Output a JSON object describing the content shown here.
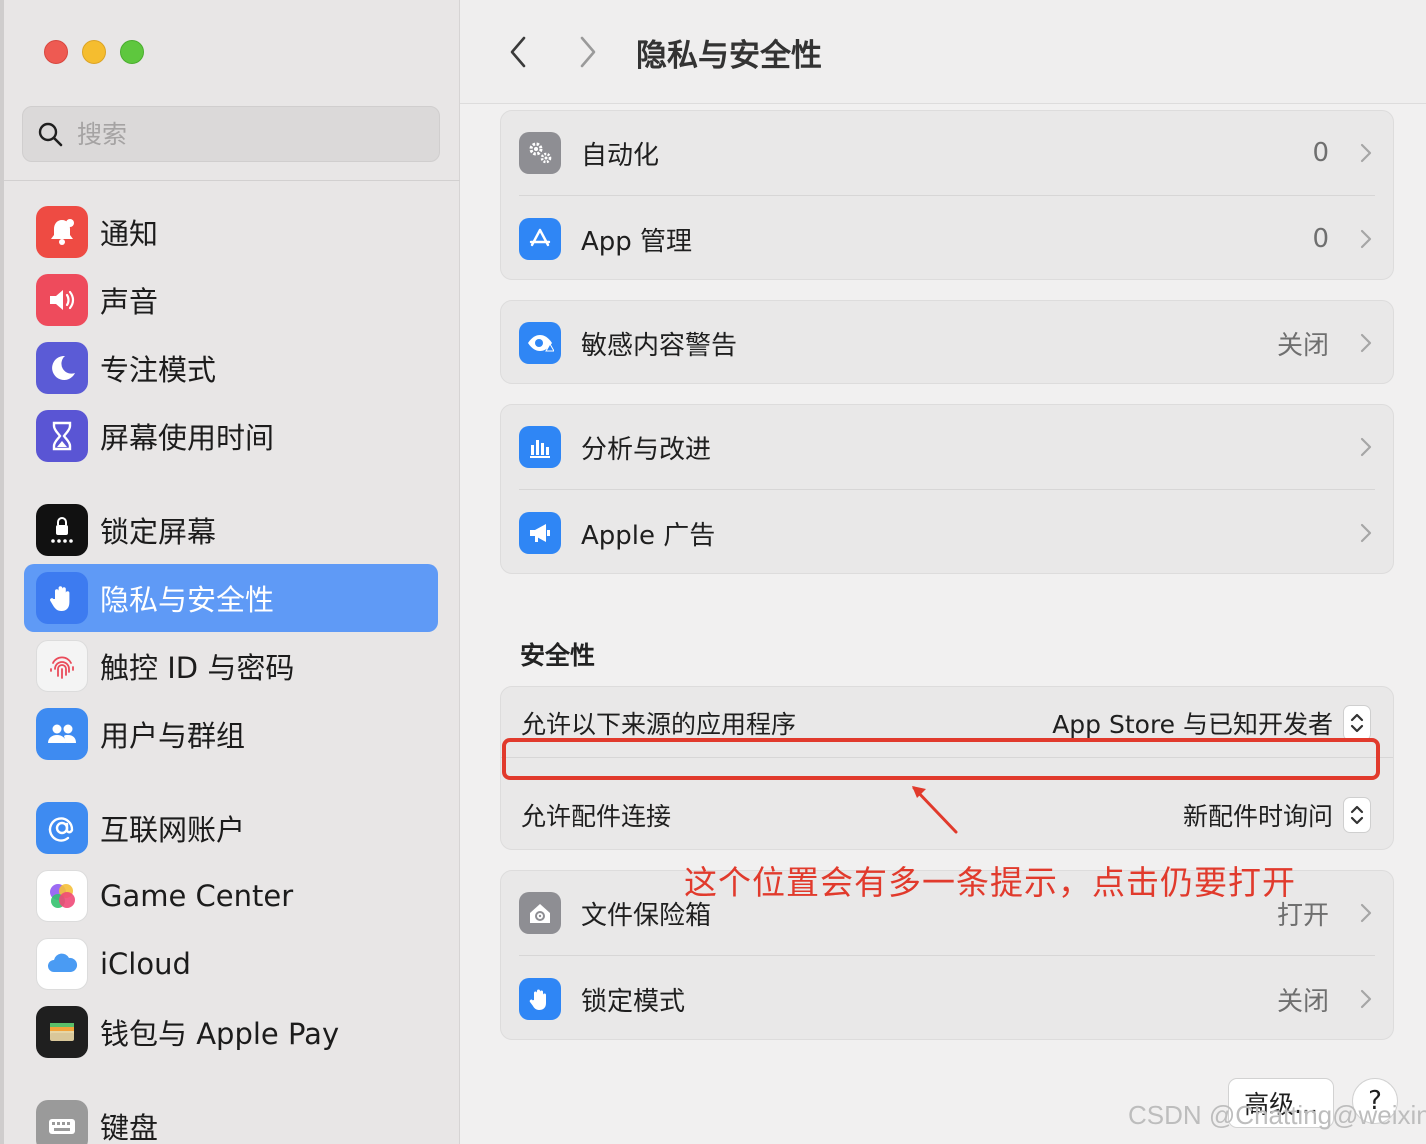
{
  "sidebar": {
    "search_placeholder": "搜索",
    "items": [
      {
        "label": "通知",
        "icon": "bell-icon",
        "color": "#ee4b43"
      },
      {
        "label": "声音",
        "icon": "speaker-icon",
        "color": "#ee4b5c"
      },
      {
        "label": "专注模式",
        "icon": "moon-icon",
        "color": "#5b5bd6"
      },
      {
        "label": "屏幕使用时间",
        "icon": "hourglass-icon",
        "color": "#5a55d4"
      },
      {
        "label": "锁定屏幕",
        "icon": "lock-screen-icon",
        "color": "#111111"
      },
      {
        "label": "隐私与安全性",
        "icon": "hand-icon",
        "color": "#3d7bf0",
        "selected": true
      },
      {
        "label": "触控 ID 与密码",
        "icon": "fingerprint-icon",
        "color": "#f4f4f4"
      },
      {
        "label": "用户与群组",
        "icon": "users-icon",
        "color": "#3e8bf1"
      },
      {
        "label": "互联网账户",
        "icon": "at-icon",
        "color": "#3e8bf1"
      },
      {
        "label": "Game Center",
        "icon": "game-center-icon",
        "color": "#ffffff"
      },
      {
        "label": "iCloud",
        "icon": "cloud-icon",
        "color": "#ffffff"
      },
      {
        "label": "钱包与 Apple Pay",
        "icon": "wallet-icon",
        "color": "#1f1f1f"
      },
      {
        "label": "键盘",
        "icon": "keyboard-icon",
        "color": "#9a9a9a"
      }
    ]
  },
  "header": {
    "title": "隐私与安全性"
  },
  "groups": {
    "g1": [
      {
        "label": "自动化",
        "value": "0",
        "icon": "gears-icon",
        "color": "#8e8e93"
      },
      {
        "label": "App 管理",
        "value": "0",
        "icon": "app-store-icon",
        "color": "#2f86f5"
      }
    ],
    "g2": [
      {
        "label": "敏感内容警告",
        "value": "关闭",
        "icon": "eye-warning-icon",
        "color": "#2f86f5"
      }
    ],
    "g3": [
      {
        "label": "分析与改进",
        "value": "",
        "icon": "bar-chart-icon",
        "color": "#2f86f5"
      },
      {
        "label": "Apple 广告",
        "value": "",
        "icon": "megaphone-icon",
        "color": "#2f86f5"
      }
    ],
    "g5": [
      {
        "label": "文件保险箱",
        "value": "打开",
        "icon": "house-lock-icon",
        "color": "#8e8e93"
      },
      {
        "label": "锁定模式",
        "value": "关闭",
        "icon": "hand-icon",
        "color": "#2f86f5"
      }
    ]
  },
  "security": {
    "section_title": "安全性",
    "allow_apps_label": "允许以下来源的应用程序",
    "allow_apps_value": "App Store 与已知开发者",
    "accessories_label": "允许配件连接",
    "accessories_value": "新配件时询问"
  },
  "annotation": {
    "text": "这个位置会有多一条提示，点击仍要打开",
    "color": "#e13a2c"
  },
  "footer": {
    "advanced_label": "高级...",
    "help_label": "?"
  },
  "watermark": "CSDN @Chatting@weixin"
}
